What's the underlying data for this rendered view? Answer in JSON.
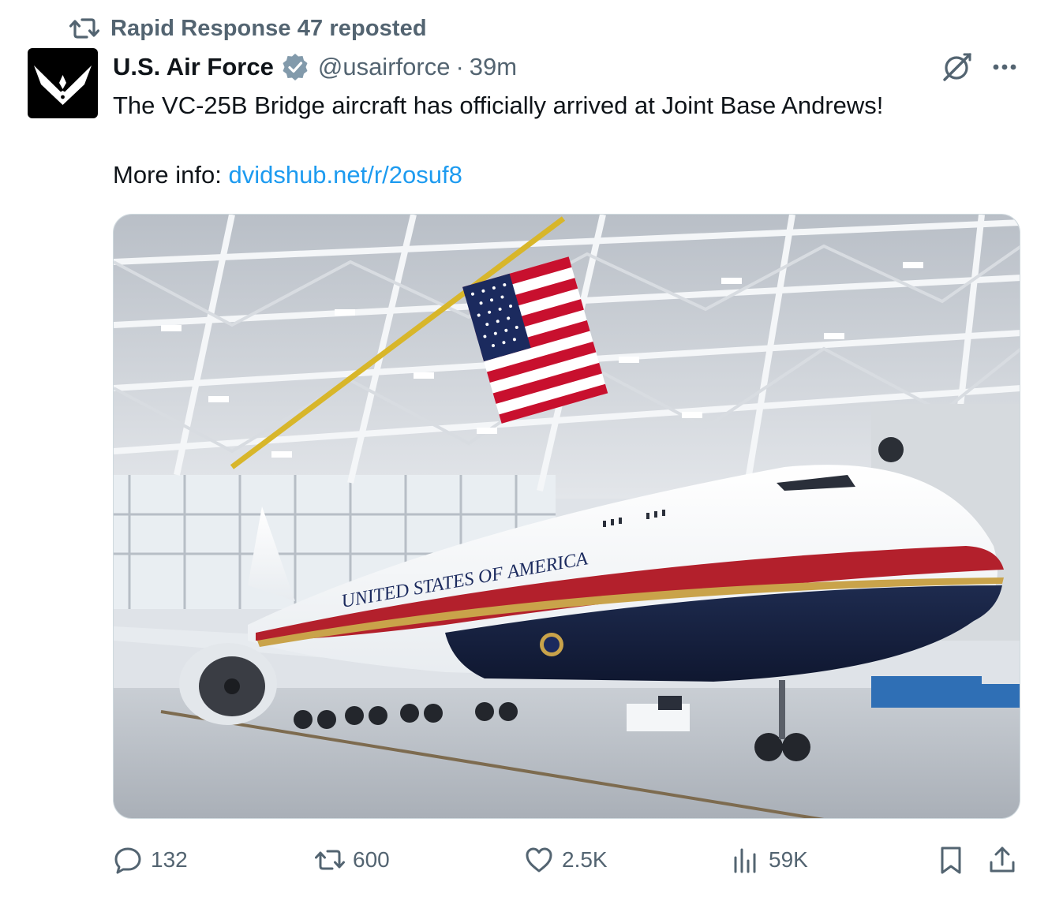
{
  "repost": {
    "text": "Rapid Response 47 reposted",
    "icon": "repost-icon"
  },
  "author": {
    "name": "U.S. Air Force",
    "handle": "@usairforce",
    "separator": "·",
    "time": "39m",
    "verified": true,
    "avatar_icon": "air-force-symbol"
  },
  "post": {
    "text_line1": "The VC-25B Bridge aircraft has officially arrived at Joint Base Andrews!",
    "more_info_label": "More info: ",
    "link_text": "dvidshub.net/r/2osuf8"
  },
  "media": {
    "alt": "VC-25B aircraft in hangar under an American flag",
    "fuselage_text": "UNITED STATES OF AMERICA"
  },
  "actions": {
    "replies": "132",
    "reposts": "600",
    "likes": "2.5K",
    "views": "59K"
  },
  "colors": {
    "text_primary": "#0f1419",
    "text_secondary": "#536471",
    "link": "#1d9bf0",
    "verified_badge": "#829aab"
  }
}
